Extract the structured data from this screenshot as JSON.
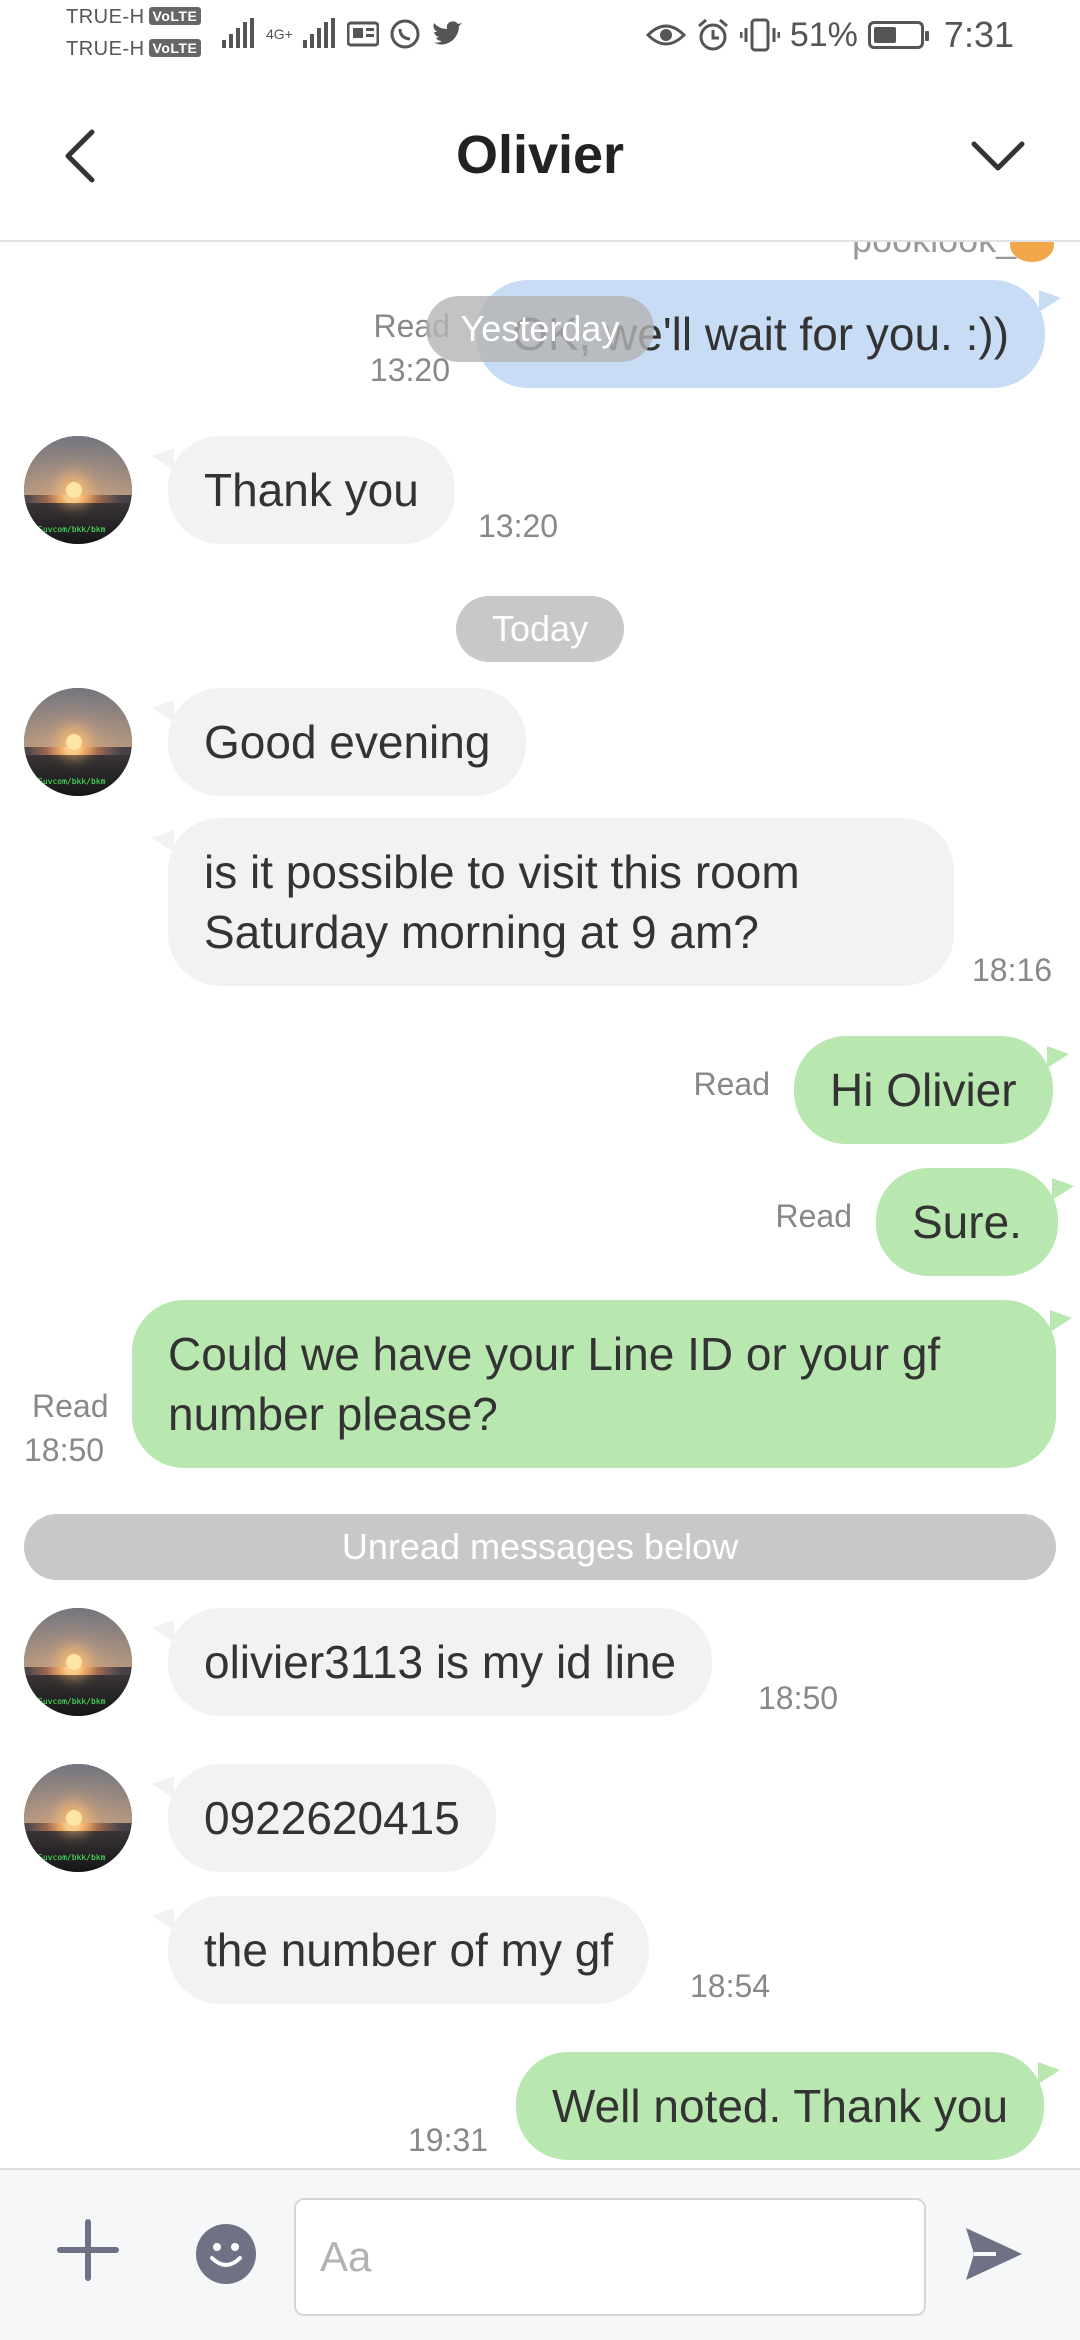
{
  "status_bar": {
    "carrier_1": "TRUE-H",
    "carrier_2": "TRUE-H",
    "volte": "VoLTE",
    "network": "4G+",
    "battery": "51%",
    "battery_level": 0.51,
    "time": "7:31"
  },
  "header": {
    "title": "Olivier"
  },
  "chat": {
    "clipped_name": "pooklook_",
    "dividers": {
      "yesterday": "Yesterday",
      "today": "Today",
      "unread": "Unread messages below"
    },
    "messages": [
      {
        "text": "OK, we'll wait for you. :))",
        "read": "Read",
        "time": "13:20"
      },
      {
        "text": "Thank you",
        "time": "13:20"
      },
      {
        "text": "Good evening"
      },
      {
        "text": "is it possible to visit this room Saturday morning at 9 am?",
        "time": "18:16"
      },
      {
        "text": "Hi Olivier",
        "read": "Read"
      },
      {
        "text": "Sure.",
        "read": "Read"
      },
      {
        "text": "Could we have your Line ID or your gf number please?",
        "read": "Read",
        "time": "18:50"
      },
      {
        "text": "olivier3113 is my id line",
        "time": "18:50"
      },
      {
        "text": "0922620415"
      },
      {
        "text": "the number of my gf",
        "time": "18:54"
      },
      {
        "text": "Well noted. Thank you",
        "time": "19:31"
      }
    ],
    "avatar_tag": "Suvcom/bkk/bkm"
  },
  "input_bar": {
    "placeholder": "Aa"
  },
  "icons": {
    "back": "chevron-left-icon",
    "menu": "chevron-down-icon",
    "add": "plus-icon",
    "emoji": "emoji-icon",
    "send": "send-icon"
  },
  "colors": {
    "incoming_bubble": "#f1f2f4",
    "outgoing_bubble": "#b8e8b0",
    "outgoing_old_bubble": "#c9dcf6",
    "divider_pill": "#c8c8c8"
  }
}
